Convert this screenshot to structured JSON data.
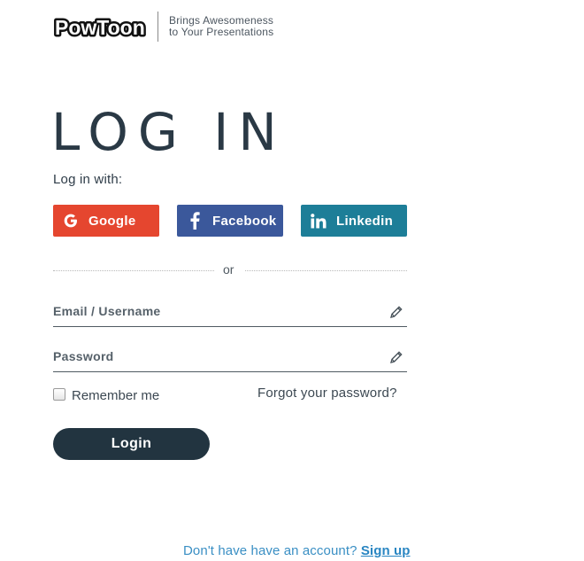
{
  "header": {
    "logo_text": "PowToon",
    "tagline_line1": "Brings Awesomeness",
    "tagline_line2": "to Your Presentations"
  },
  "title": "LOG IN",
  "login_with_label": "Log in with:",
  "social": {
    "google_label": "Google",
    "facebook_label": "Facebook",
    "linkedin_label": "Linkedin"
  },
  "separator_text": "or",
  "form": {
    "email_placeholder": "Email / Username",
    "email_value": "",
    "password_placeholder": "Password",
    "password_value": "",
    "remember_label": "Remember me",
    "remember_checked": false,
    "forgot_label": "Forgot your password?",
    "login_label": "Login"
  },
  "footer": {
    "prompt": "Don't have have an account?",
    "signup_label": "Sign up"
  },
  "colors": {
    "google": "#e5462f",
    "facebook": "#3b589b",
    "linkedin": "#1d7e98",
    "login_button": "#223440",
    "link_blue": "#2a86c2"
  },
  "icons": [
    "powtoon-logo",
    "google-icon",
    "facebook-icon",
    "linkedin-icon",
    "pencil-icon"
  ]
}
